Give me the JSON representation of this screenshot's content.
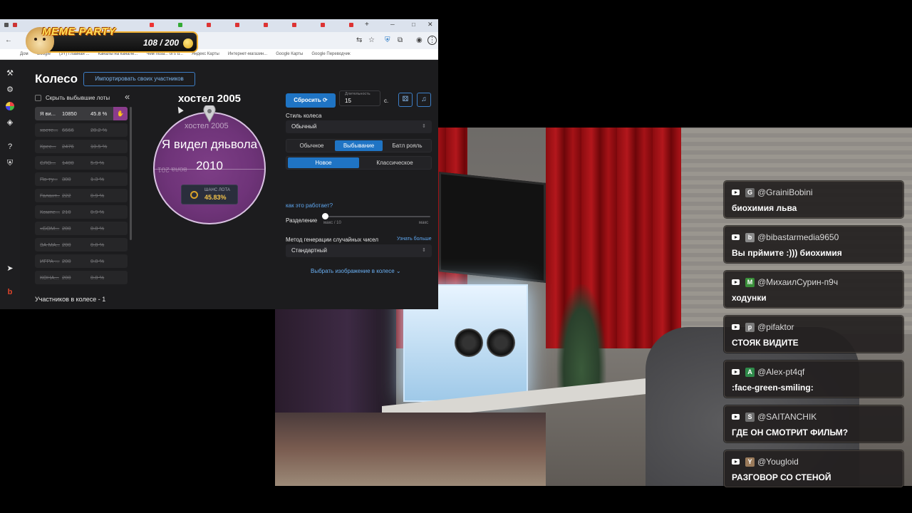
{
  "overlay": {
    "title": "MEME PARTY",
    "count": "108 / 200"
  },
  "browser": {
    "bookmarks": [
      "Дом",
      "Google",
      "(3Y) Главная ...",
      "Каналы на канале...",
      "Чем поза... of's d...",
      "Яндекс Карты",
      "Интернет-магазин...",
      "Google Карты",
      "Google Переводчик"
    ]
  },
  "app": {
    "title": "Колесо",
    "import_label": "Импортировать своих участников",
    "hide_label": "Скрыть выбывшие лоты",
    "collapse_icon": "«",
    "lots": [
      {
        "name": "Я ви...",
        "amount": "10850",
        "pct": "45.8 %",
        "active": true
      },
      {
        "name": "хосте...",
        "amount": "6666",
        "pct": "28.2 %"
      },
      {
        "name": "Крес...",
        "amount": "2476",
        "pct": "10.5 %"
      },
      {
        "name": "СЛО...",
        "amount": "1400",
        "pct": "5.9 %"
      },
      {
        "name": "По-ту...",
        "amount": "300",
        "pct": "1.3 %"
      },
      {
        "name": "Галант...",
        "amount": "222",
        "pct": "0.9 %"
      },
      {
        "name": "Компе...",
        "amount": "210",
        "pct": "0.9 %"
      },
      {
        "name": "«БОМ...",
        "amount": "200",
        "pct": "0.8 %"
      },
      {
        "name": "ЗА МА...",
        "amount": "200",
        "pct": "0.8 %"
      },
      {
        "name": "ИГРА-...",
        "amount": "200",
        "pct": "0.8 %"
      },
      {
        "name": "КОНА...",
        "amount": "200",
        "pct": "0.8 %"
      }
    ],
    "participants": "Участников в колесе - 1",
    "wheel": {
      "title": "хостел 2005",
      "segment_label": "хостел 2005",
      "mirror_label": "вола 201",
      "center_text_1": "Я видел дяьвола",
      "center_text_2": "2010",
      "chance_label": "ШАНС ЛОТА",
      "chance_value": "45.83%"
    },
    "controls": {
      "reset_label": "Сбросить",
      "duration_label": "Длительность",
      "duration_value": "15",
      "duration_unit": "с.",
      "style_label": "Стиль колеса",
      "style_value": "Обычный",
      "modes": [
        "Обычное",
        "Выбывание",
        "Батл рояль"
      ],
      "selected_mode": "Выбывание",
      "variants": [
        "Новое",
        "Классическое"
      ],
      "selected_variant": "Новое",
      "how_link": "как это работает?",
      "split_label": "Разделение",
      "split_min": "макс / 10",
      "split_max": "макс",
      "split_value": 0,
      "rng_label": "Метод генерации случайных чисел",
      "learn_more": "Узнать больше",
      "rng_value": "Стандартный",
      "choose_image": "Выбрать изображение в колесе"
    }
  },
  "chat": [
    {
      "author": "@GrainiBobini",
      "text": "биохимия льва",
      "avatar": "G",
      "color": "#6b6b6b"
    },
    {
      "author": "@bibastarmedia9650",
      "text": "Вы прймите :))) биохимия",
      "avatar": "b",
      "color": "#8a8a8a"
    },
    {
      "author": "@МихаилСурин-п9ч",
      "text": "ходунки",
      "avatar": "М",
      "color": "#3a8f3a"
    },
    {
      "author": "@pifaktor",
      "text": "СТОЯК ВИДИТЕ",
      "avatar": "p",
      "color": "#7a7a7a"
    },
    {
      "author": "@Alex-pt4qf",
      "text": ":face-green-smiling:",
      "avatar": "A",
      "color": "#2f8a4a"
    },
    {
      "author": "@SAITANCHIK",
      "text": "ГДЕ ОН СМОТРИТ ФИЛЬМ?",
      "avatar": "S",
      "color": "#707070"
    },
    {
      "author": "@Yougloid",
      "text": "РАЗГОВОР СО СТЕНОЙ",
      "avatar": "Y",
      "color": "#9a7a5a"
    }
  ]
}
